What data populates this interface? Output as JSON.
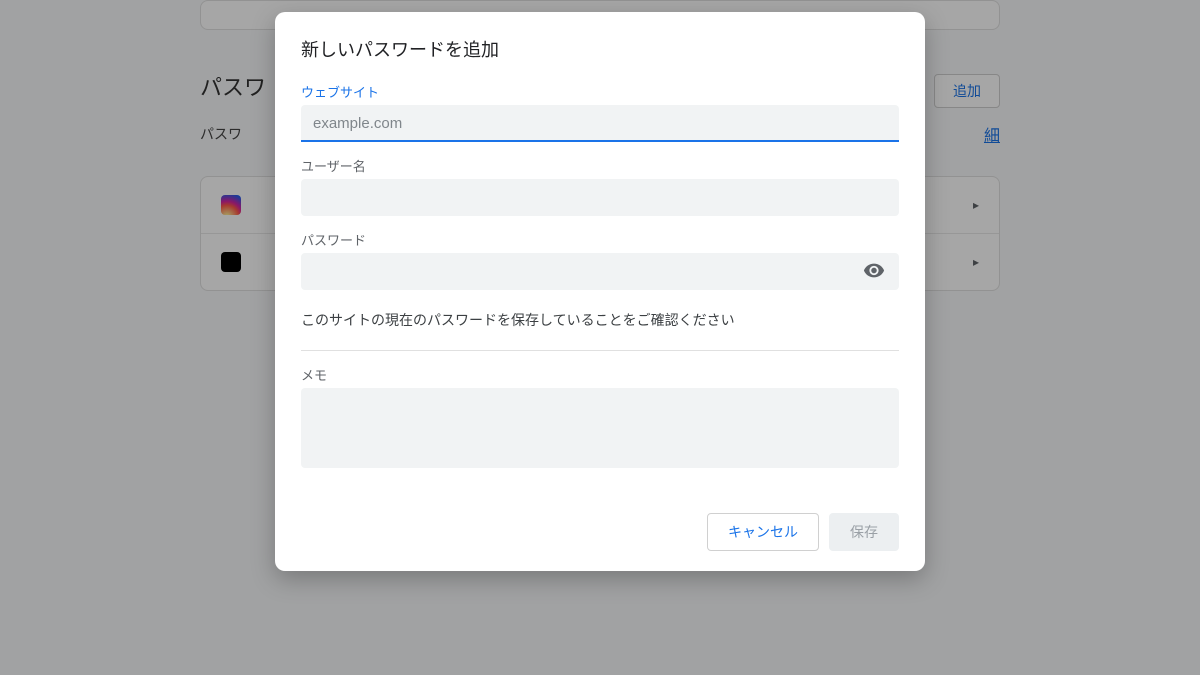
{
  "background": {
    "heading": "パスワ",
    "subtext": "パスワ",
    "detail_link": "細",
    "add_button": "追加",
    "rows": [
      "instagram",
      "x"
    ]
  },
  "modal": {
    "title": "新しいパスワードを追加",
    "website_label": "ウェブサイト",
    "website_placeholder": "example.com",
    "website_value": "",
    "username_label": "ユーザー名",
    "username_value": "",
    "password_label": "パスワード",
    "password_value": "",
    "helper_text": "このサイトの現在のパスワードを保存していることをご確認ください",
    "memo_label": "メモ",
    "memo_value": "",
    "cancel_label": "キャンセル",
    "save_label": "保存"
  }
}
